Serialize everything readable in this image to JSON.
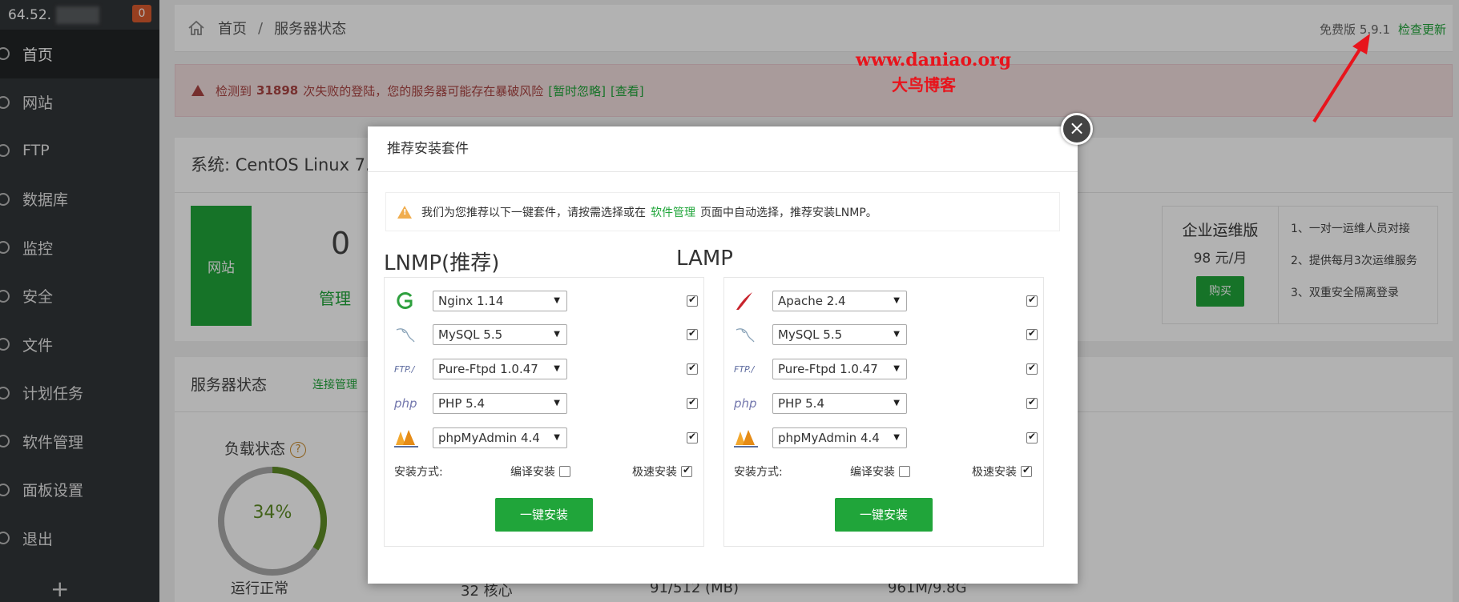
{
  "sidebar": {
    "ip": "64.52.",
    "badge": "0",
    "items": [
      {
        "label": "首页",
        "icon": "home-icon"
      },
      {
        "label": "网站",
        "icon": "globe-icon"
      },
      {
        "label": "FTP",
        "icon": "ftp-icon"
      },
      {
        "label": "数据库",
        "icon": "database-icon"
      },
      {
        "label": "监控",
        "icon": "monitor-icon"
      },
      {
        "label": "安全",
        "icon": "shield-icon"
      },
      {
        "label": "文件",
        "icon": "folder-icon"
      },
      {
        "label": "计划任务",
        "icon": "calendar-icon"
      },
      {
        "label": "软件管理",
        "icon": "apps-icon"
      },
      {
        "label": "面板设置",
        "icon": "settings-icon"
      },
      {
        "label": "退出",
        "icon": "logout-icon"
      }
    ],
    "add": "+"
  },
  "header": {
    "home": "首页",
    "sep": "/",
    "current": "服务器状态",
    "version": "免费版 5.9.1",
    "update": "检查更新"
  },
  "alert": {
    "pre": "检测到",
    "count": "31898",
    "post": "次失败的登陆，您的服务器可能存在暴破风险",
    "ignore": "[暂时忽略]",
    "view": "[查看]"
  },
  "system": {
    "title": "系统: CentOS Linux 7.",
    "site_label": "网站",
    "site_count": "0",
    "manage": "管理",
    "enterprise": {
      "title": "企业运维版",
      "price": "98 元/月",
      "buy": "购买",
      "features": [
        "1、一对一运维人员对接",
        "2、提供每月3次运维服务",
        "3、双重安全隔离登录"
      ]
    }
  },
  "server": {
    "title": "服务器状态",
    "link": "连接管理",
    "load_title": "负载状态",
    "load_value": "34%",
    "load_fraction": 0.34,
    "load_status": "运行正常",
    "cores": "32 核心",
    "memory": "91/512 (MB)",
    "disk": "961M/9.8G"
  },
  "watermark": {
    "url": "www.daniao.org",
    "name": "大鸟博客"
  },
  "modal": {
    "title": "推荐安装套件",
    "close": "×",
    "tip_pre": "我们为您推荐以下一键套件，请按需选择或在",
    "tip_link": "软件管理",
    "tip_post": "页面中自动选择，推荐安装LNMP。",
    "lnmp": {
      "title": "LNMP(推荐)",
      "items": [
        {
          "name": "Nginx 1.14",
          "icon": "nginx-icon",
          "checked": true
        },
        {
          "name": "MySQL 5.5",
          "icon": "mysql-icon",
          "checked": true
        },
        {
          "name": "Pure-Ftpd 1.0.47",
          "icon": "ftp-icon",
          "checked": true
        },
        {
          "name": "PHP 5.4",
          "icon": "php-icon",
          "checked": true
        },
        {
          "name": "phpMyAdmin 4.4",
          "icon": "phpmyadmin-icon",
          "checked": true
        }
      ],
      "method_label": "安装方式:",
      "compile": "编译安装",
      "fast": "极速安装",
      "button": "一键安装"
    },
    "lamp": {
      "title": "LAMP",
      "items": [
        {
          "name": "Apache 2.4",
          "icon": "apache-icon",
          "checked": true
        },
        {
          "name": "MySQL 5.5",
          "icon": "mysql-icon",
          "checked": true
        },
        {
          "name": "Pure-Ftpd 1.0.47",
          "icon": "ftp-icon",
          "checked": true
        },
        {
          "name": "PHP 5.4",
          "icon": "php-icon",
          "checked": true
        },
        {
          "name": "phpMyAdmin 4.4",
          "icon": "phpmyadmin-icon",
          "checked": true
        }
      ],
      "method_label": "安装方式:",
      "compile": "编译安装",
      "fast": "极速安装",
      "button": "一键安装"
    },
    "ftp_logo_text": "FTP./",
    "php_logo_text": "php"
  },
  "colors": {
    "accent": "#20a53a",
    "watermark": "#e8141c",
    "alert_text": "#a94442"
  }
}
